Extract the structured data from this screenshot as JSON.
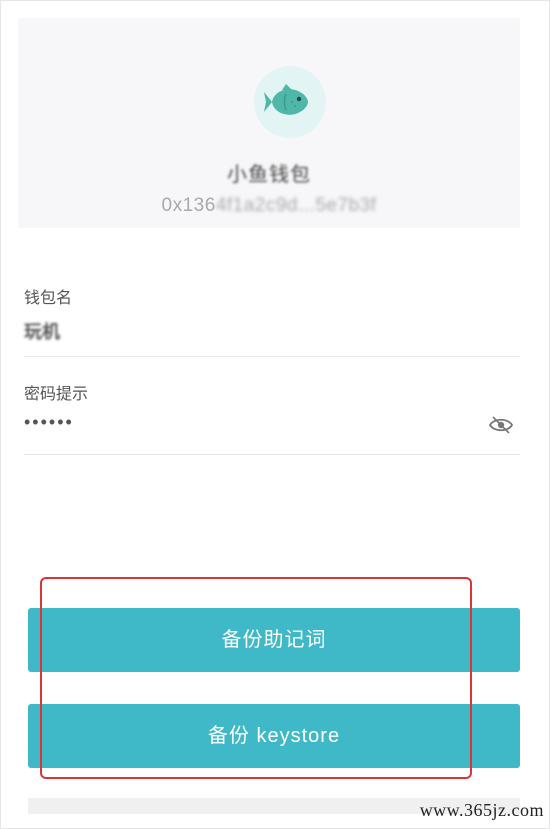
{
  "header": {
    "avatar_icon": "fish-icon",
    "wallet_name": "小鱼钱包",
    "address_prefix": "0x136",
    "address_rest": "4f1a2c9d...5e7b3f"
  },
  "form": {
    "wallet_name_label": "钱包名",
    "wallet_name_value": "玩机",
    "password_hint_label": "密码提示",
    "password_hint_value": "••••••",
    "visibility_icon": "eye-icon"
  },
  "actions": {
    "backup_mnemonic": "备份助记词",
    "backup_keystore": "备份 keystore"
  },
  "colors": {
    "accent": "#3fb9c8",
    "highlight_border": "#d9353a",
    "header_bg": "#f7f7f9"
  },
  "watermark": "www.365jz.com"
}
